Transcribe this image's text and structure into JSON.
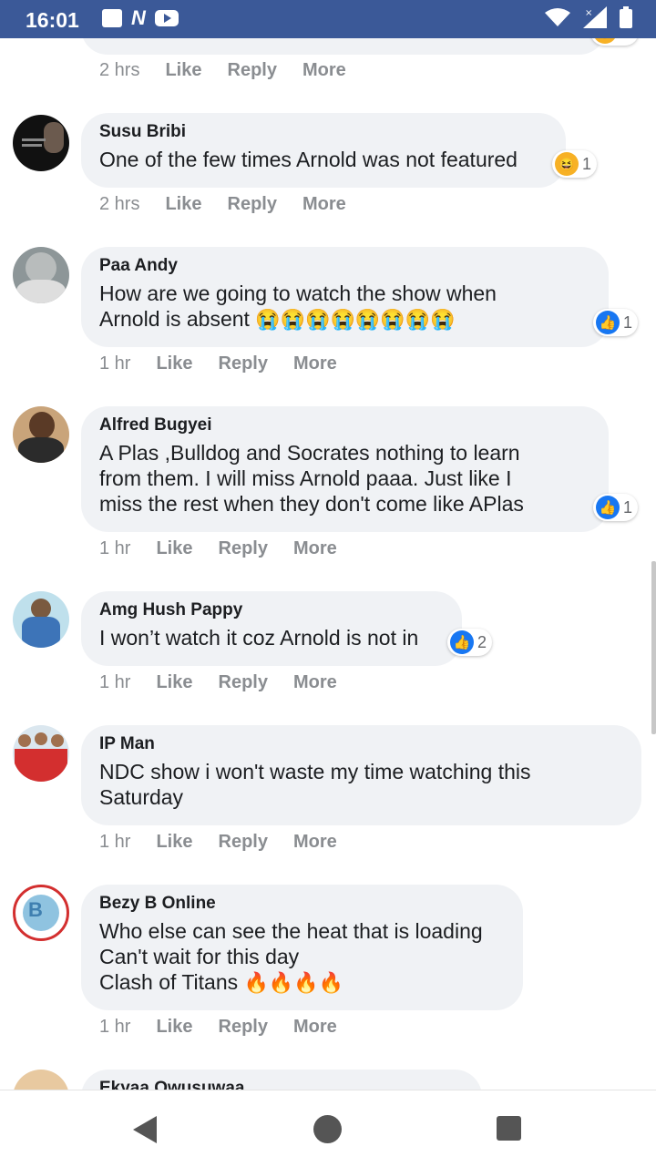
{
  "status_bar": {
    "time": "16:01"
  },
  "top_partial": {
    "time": "2 hrs",
    "like": "Like",
    "reply": "Reply",
    "more": "More"
  },
  "comments": [
    {
      "author": "Susu Bribi",
      "text": "One of the few times Arnold was not featured",
      "reaction": "haha",
      "reaction_count": "1",
      "time": "2 hrs",
      "like": "Like",
      "reply": "Reply",
      "more": "More"
    },
    {
      "author": "Paa Andy",
      "text": "How are we going to watch the show when\nArnold is absent",
      "emojis": "😭😭😭😭😭😭😭😭",
      "reaction": "like",
      "reaction_count": "1",
      "time": "1 hr",
      "like": "Like",
      "reply": "Reply",
      "more": "More"
    },
    {
      "author": "Alfred Bugyei",
      "text": "A Plas ,Bulldog and Socrates nothing to learn\nfrom them. I will miss Arnold paaa. Just like I\nmiss the rest when they don't come like APlas",
      "reaction": "like",
      "reaction_count": "1",
      "time": "1 hr",
      "like": "Like",
      "reply": "Reply",
      "more": "More"
    },
    {
      "author": "Amg Hush Pappy",
      "text": "I won’t watch it coz Arnold is not in",
      "reaction": "like",
      "reaction_count": "2",
      "time": "1 hr",
      "like": "Like",
      "reply": "Reply",
      "more": "More"
    },
    {
      "author": "IP Man",
      "text": "NDC show i won't waste my time watching this\nSaturday",
      "time": "1 hr",
      "like": "Like",
      "reply": "Reply",
      "more": "More"
    },
    {
      "author": "Bezy B Online",
      "text": "Who else can see the heat that is loading\nCan't wait for this day\nClash of Titans",
      "emojis": "🔥🔥🔥🔥",
      "time": "1 hr",
      "like": "Like",
      "reply": "Reply",
      "more": "More"
    },
    {
      "author": "Ekyaa Owusuwaa"
    }
  ],
  "icons": {
    "like": "thumbs-up-icon",
    "haha": "laughing-face-icon",
    "back": "back-triangle-icon",
    "home": "home-circle-icon",
    "recent": "recent-apps-square-icon"
  },
  "colors": {
    "status_bar": "#3b5998",
    "bubble": "#f0f2f5",
    "like_blue": "#1877f2",
    "meta_gray": "#8a8d91"
  }
}
